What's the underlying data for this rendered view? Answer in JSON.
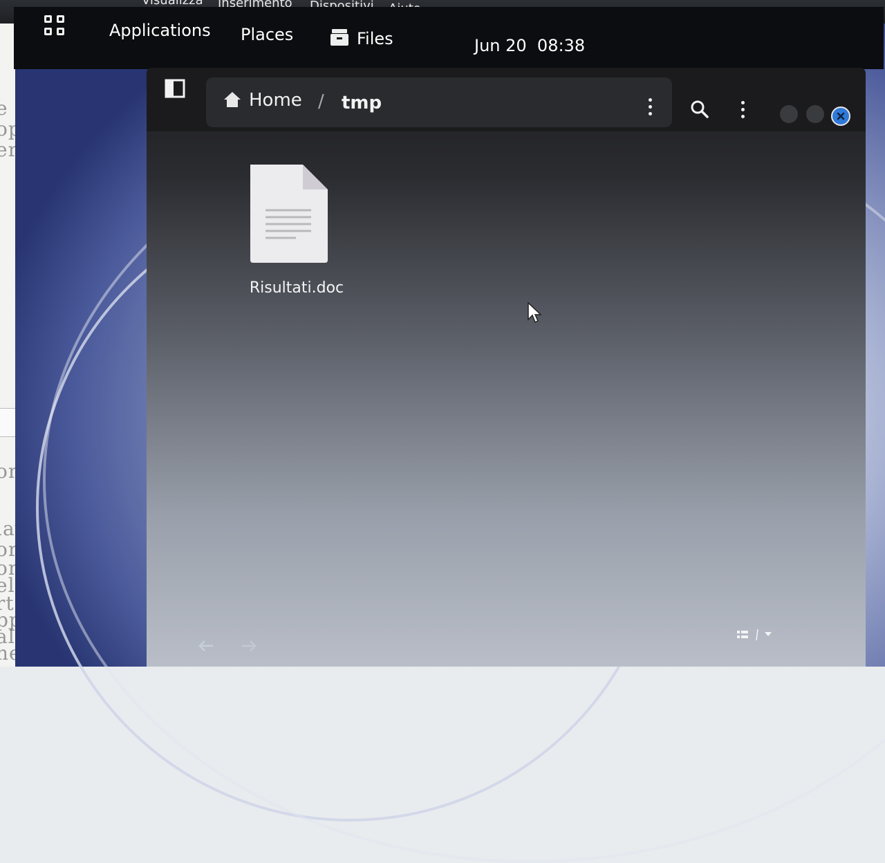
{
  "vm_menubar": {
    "items": [
      "Visualizza",
      "Inserimento",
      "Dispositivi",
      "Aiuto"
    ]
  },
  "host_document": {
    "ghost_text": [
      "e",
      "op",
      "er",
      "n",
      "ompi",
      "lavo",
      "orso",
      "ompit",
      "elazio",
      "rtella",
      "ppo",
      "altri",
      "nentre"
    ]
  },
  "topbar": {
    "activities_icon": "grid-icon",
    "applications_label": "Applications",
    "places_label": "Places",
    "files_label": "Files",
    "files_icon": "file-cabinet-icon",
    "clock": "Jun 20  08:38"
  },
  "window": {
    "sidebar_toggle_icon": "sidebar-toggle-icon",
    "path": {
      "home_icon": "home-icon",
      "home_label": "Home",
      "separator": "/",
      "current": "tmp"
    },
    "buttons": {
      "path_menu": "kebab-icon",
      "search": "search-icon",
      "main_menu": "kebab-icon",
      "close": "close-icon"
    },
    "files": [
      {
        "name": "Risultati.doc",
        "icon": "document-icon"
      }
    ],
    "footer": {
      "back_icon": "arrow-left-icon",
      "forward_icon": "arrow-right-icon",
      "view_icon": "list-view-icon"
    }
  },
  "colors": {
    "close_button": "#2f79d8",
    "headerbar": "#1b1b1d",
    "topbar": "#0c0d10"
  }
}
